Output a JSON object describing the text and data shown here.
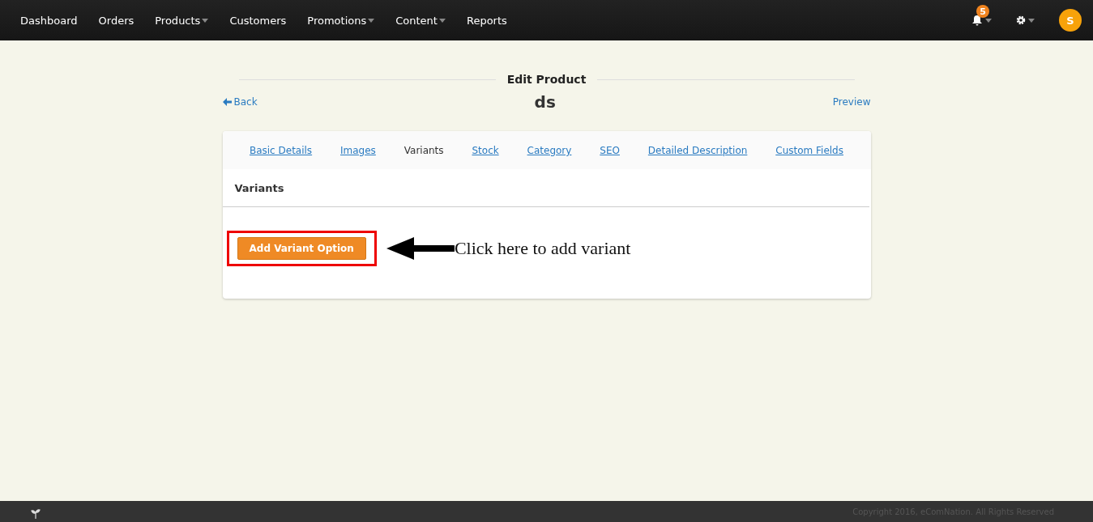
{
  "nav": {
    "items": [
      {
        "label": "Dashboard",
        "dropdown": false
      },
      {
        "label": "Orders",
        "dropdown": false
      },
      {
        "label": "Products",
        "dropdown": true
      },
      {
        "label": "Customers",
        "dropdown": false
      },
      {
        "label": "Promotions",
        "dropdown": true
      },
      {
        "label": "Content",
        "dropdown": true
      },
      {
        "label": "Reports",
        "dropdown": false
      }
    ],
    "notifications_badge": "5",
    "avatar": "S"
  },
  "page": {
    "heading": "Edit Product",
    "back": "Back",
    "title": "ds",
    "preview": "Preview"
  },
  "tabs": [
    {
      "label": "Basic Details",
      "selected": false
    },
    {
      "label": "Images",
      "selected": false
    },
    {
      "label": "Variants",
      "selected": true
    },
    {
      "label": "Stock",
      "selected": false
    },
    {
      "label": "Category",
      "selected": false
    },
    {
      "label": "SEO",
      "selected": false
    },
    {
      "label": "Detailed Description",
      "selected": false
    },
    {
      "label": "Custom Fields",
      "selected": false
    }
  ],
  "panel": {
    "title": "Variants",
    "button": "Add Variant Option",
    "annotation": "Click here to add variant"
  },
  "footer": {
    "copyright": "Copyright 2016, eComNation. All Rights Reserved"
  }
}
